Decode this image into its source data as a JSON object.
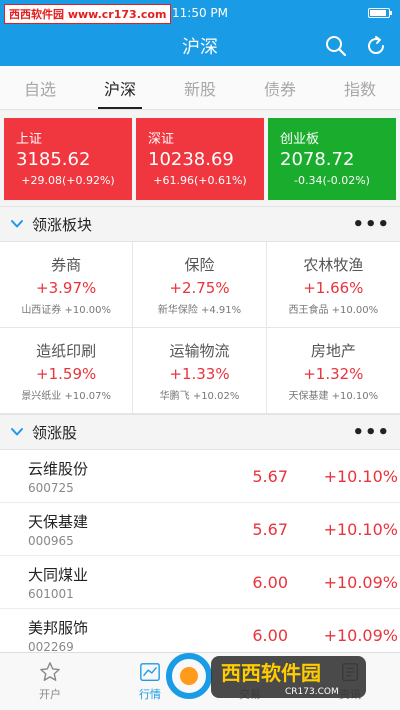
{
  "status_bar": {
    "watermark": "西西软件园 www.cr173.com",
    "time": "11:50 PM",
    "battery_level": 0.9
  },
  "header": {
    "title": "沪深"
  },
  "tabs": [
    {
      "label": "自选",
      "active": false
    },
    {
      "label": "沪深",
      "active": true
    },
    {
      "label": "新股",
      "active": false
    },
    {
      "label": "债券",
      "active": false
    },
    {
      "label": "指数",
      "active": false
    }
  ],
  "indices": [
    {
      "name": "上证",
      "value": "3185.62",
      "change": "+29.08(+0.92%)",
      "color": "#f0363f"
    },
    {
      "name": "深证",
      "value": "10238.69",
      "change": "+61.96(+0.61%)",
      "color": "#f0363f"
    },
    {
      "name": "创业板",
      "value": "2078.72",
      "change": "-0.34(-0.02%)",
      "color": "#1aad2d"
    }
  ],
  "sectors_section": {
    "label": "领涨板块",
    "more": "•••"
  },
  "sectors": [
    {
      "name": "券商",
      "pct": "+3.97%",
      "leader": "山西证券 +10.00%"
    },
    {
      "name": "保险",
      "pct": "+2.75%",
      "leader": "新华保险 +4.91%"
    },
    {
      "name": "农林牧渔",
      "pct": "+1.66%",
      "leader": "西王食品 +10.00%"
    },
    {
      "name": "造纸印刷",
      "pct": "+1.59%",
      "leader": "景兴纸业 +10.07%"
    },
    {
      "name": "运输物流",
      "pct": "+1.33%",
      "leader": "华鹏飞 +10.02%"
    },
    {
      "name": "房地产",
      "pct": "+1.32%",
      "leader": "天保基建 +10.10%"
    }
  ],
  "stocks_section": {
    "label": "领涨股",
    "more": "•••"
  },
  "stocks": [
    {
      "name": "云维股份",
      "code": "600725",
      "price": "5.67",
      "pct": "+10.10%"
    },
    {
      "name": "天保基建",
      "code": "000965",
      "price": "5.67",
      "pct": "+10.10%"
    },
    {
      "name": "大同煤业",
      "code": "601001",
      "price": "6.00",
      "pct": "+10.09%"
    },
    {
      "name": "美邦服饰",
      "code": "002269",
      "price": "6.00",
      "pct": "+10.09%"
    }
  ],
  "bottom_nav": [
    {
      "label": "开户",
      "icon": "star-icon",
      "active": false
    },
    {
      "label": "行情",
      "icon": "chart-icon",
      "active": true
    },
    {
      "label": "交易",
      "icon": "trade-icon",
      "active": false
    },
    {
      "label": "资讯",
      "icon": "news-icon",
      "active": false
    }
  ],
  "watermark_logo": {
    "brand": "西西软件园",
    "url": "CR173.COM"
  },
  "colors": {
    "brand_blue": "#1a9be6",
    "up_red": "#e8343c",
    "down_green": "#1aad2d"
  }
}
